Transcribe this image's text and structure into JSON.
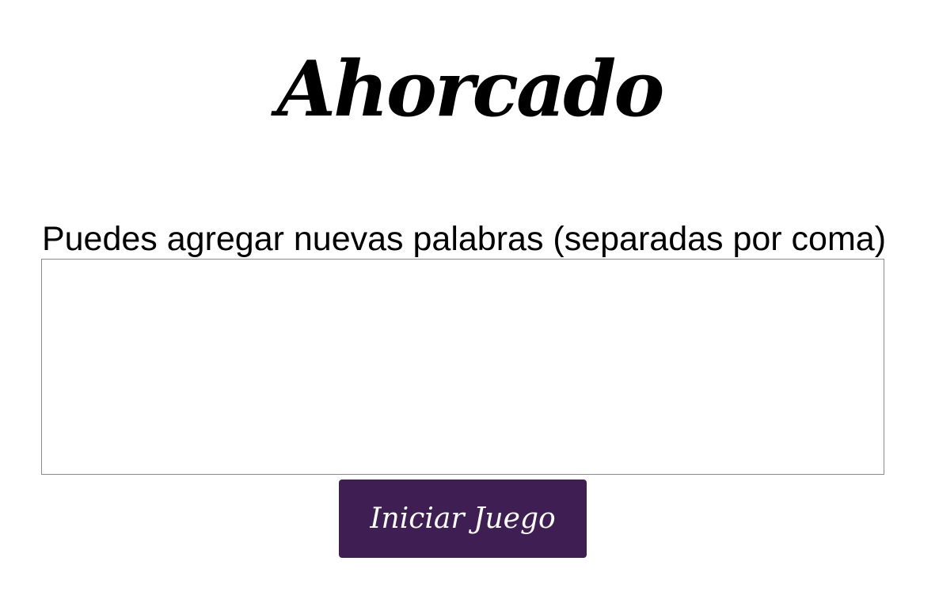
{
  "header": {
    "title": "Ahorcado"
  },
  "form": {
    "prompt_label": "Puedes agregar nuevas palabras (separadas por coma)",
    "textarea_value": "",
    "textarea_placeholder": "",
    "start_button_label": "Iniciar Juego"
  },
  "colors": {
    "background": "#ffffff",
    "text": "#000000",
    "button_background": "#3f1f53",
    "button_text": "#ffffff",
    "textarea_border": "#8a8a8a"
  }
}
